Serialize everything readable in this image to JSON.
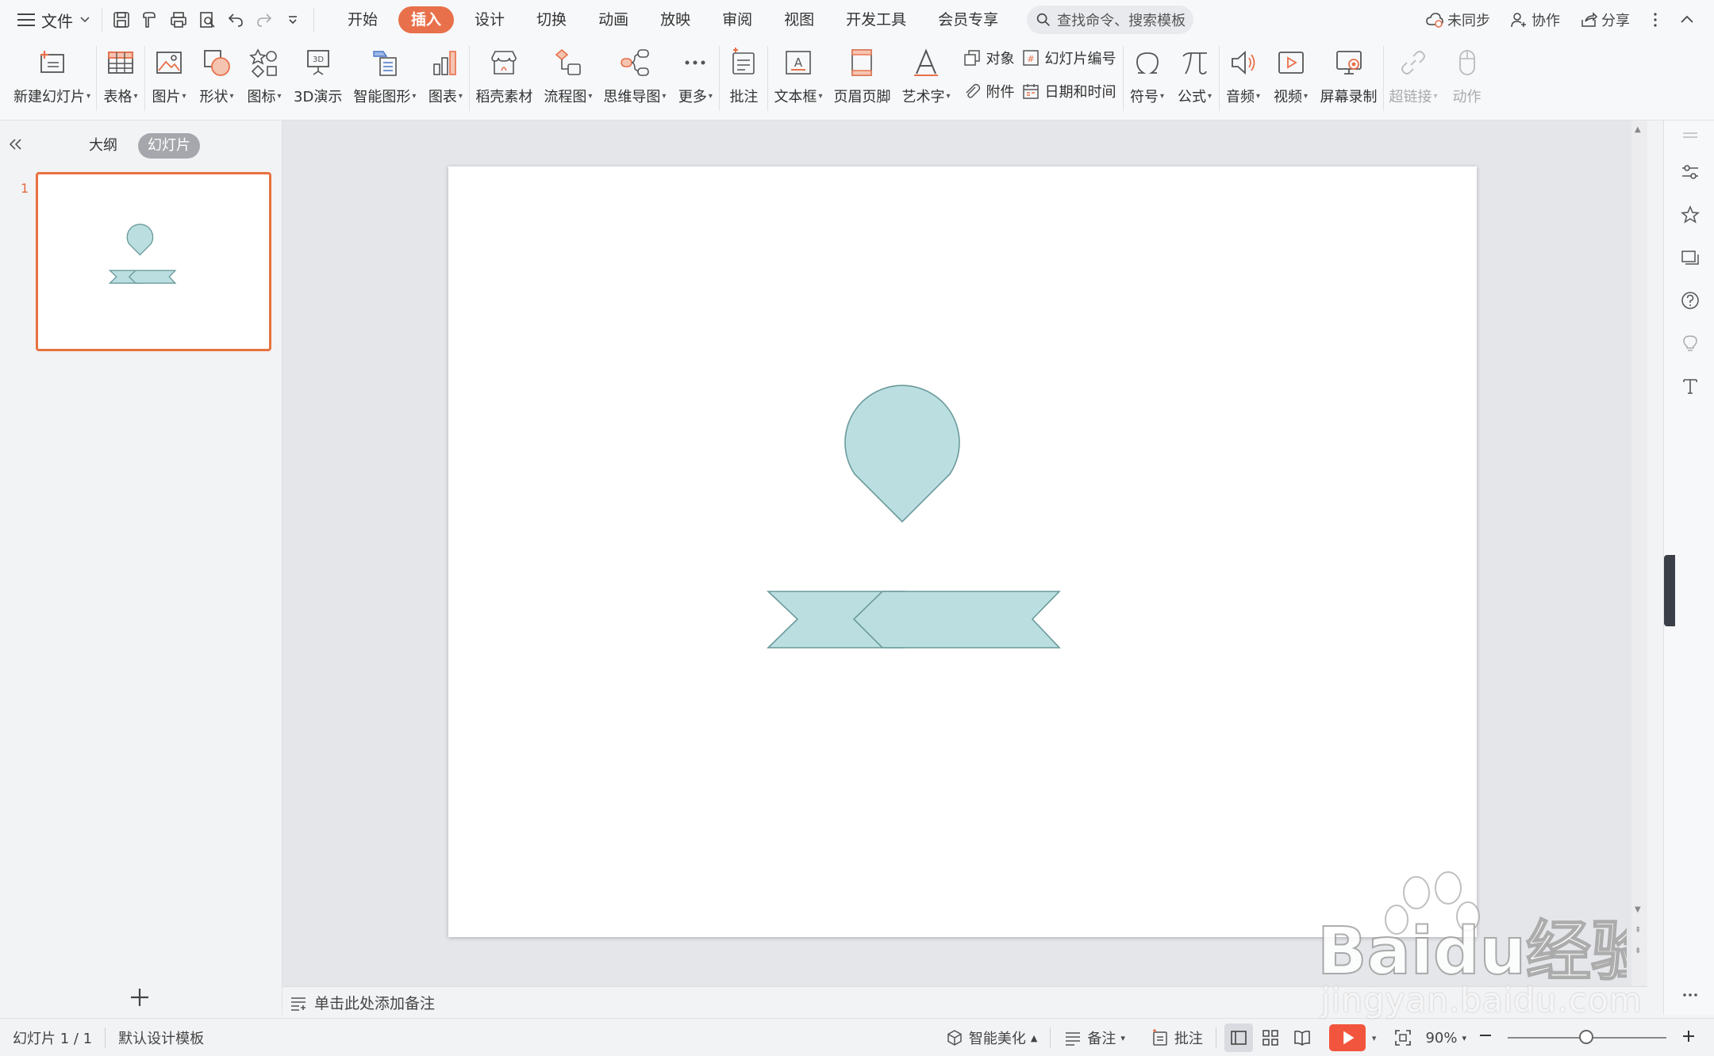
{
  "menubar": {
    "file_label": "文件",
    "tabs": [
      {
        "label": "开始"
      },
      {
        "label": "插入",
        "active": true
      },
      {
        "label": "设计"
      },
      {
        "label": "切换"
      },
      {
        "label": "动画"
      },
      {
        "label": "放映"
      },
      {
        "label": "审阅"
      },
      {
        "label": "视图"
      },
      {
        "label": "开发工具"
      },
      {
        "label": "会员专享"
      }
    ],
    "search_placeholder": "查找命令、搜索模板",
    "sync_label": "未同步",
    "collab_label": "协作",
    "share_label": "分享"
  },
  "ribbon": {
    "new_slide": "新建幻灯片",
    "table": "表格",
    "picture": "图片",
    "shape": "形状",
    "icon": "图标",
    "demo3d": "3D演示",
    "smartart": "智能图形",
    "chart": "图表",
    "material": "稻壳素材",
    "flowchart": "流程图",
    "mindmap": "思维导图",
    "more": "更多",
    "comment": "批注",
    "textbox": "文本框",
    "header_footer": "页眉页脚",
    "wordart": "艺术字",
    "object": "对象",
    "slide_number": "幻灯片编号",
    "attachment": "附件",
    "datetime": "日期和时间",
    "symbol": "符号",
    "formula": "公式",
    "audio": "音频",
    "video": "视频",
    "screen_record": "屏幕录制",
    "hyperlink": "超链接",
    "action": "动作"
  },
  "leftpanel": {
    "tab_outline": "大纲",
    "tab_slides": "幻灯片",
    "slide_number": "1"
  },
  "notes": {
    "placeholder": "单击此处添加备注"
  },
  "statusbar": {
    "slide_info": "幻灯片 1 / 1",
    "template": "默认设计模板",
    "beautify": "智能美化",
    "notes": "备注",
    "comment": "批注",
    "zoom": "90%"
  },
  "slide": {
    "shape_fill": "#bbdfe1",
    "shape_stroke": "#6b9a9c"
  },
  "watermark": {
    "brand": "Baidu经验",
    "url": "jingyan.baidu.com"
  },
  "colors": {
    "accent": "#e8704a",
    "play": "#f2553d"
  }
}
